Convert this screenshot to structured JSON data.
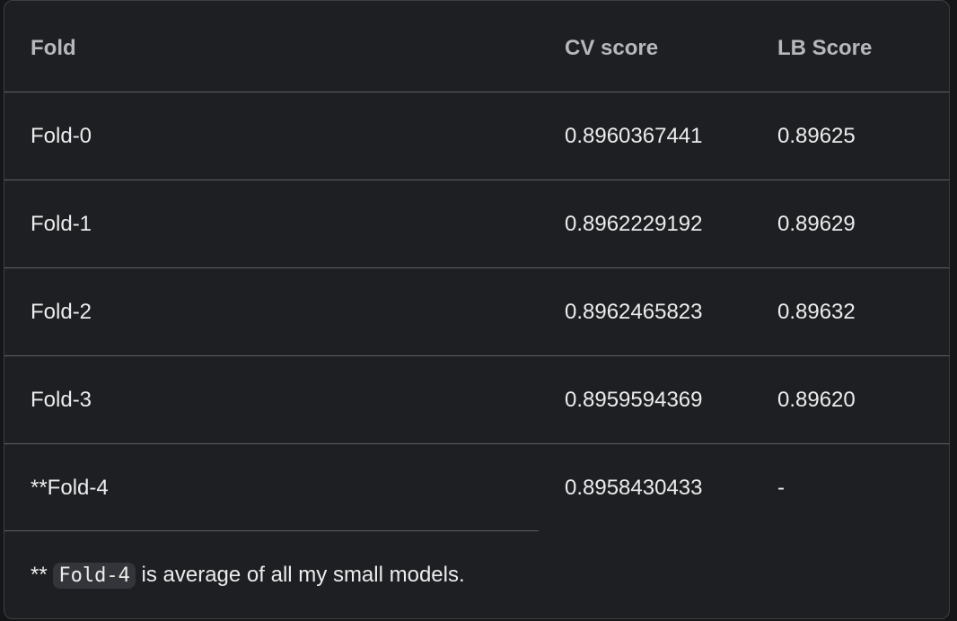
{
  "table": {
    "headers": [
      "Fold",
      "CV score",
      "LB Score"
    ],
    "rows": [
      [
        "Fold-0",
        "0.8960367441",
        "0.89625"
      ],
      [
        "Fold-1",
        "0.8962229192",
        "0.89629"
      ],
      [
        "Fold-2",
        "0.8962465823",
        "0.89632"
      ],
      [
        "Fold-3",
        "0.8959594369",
        "0.89620"
      ],
      [
        "**Fold-4",
        "0.8958430433",
        "-"
      ]
    ]
  },
  "footnote": {
    "prefix": "**",
    "code": "Fold-4",
    "suffix": "is average of all my small models."
  }
}
